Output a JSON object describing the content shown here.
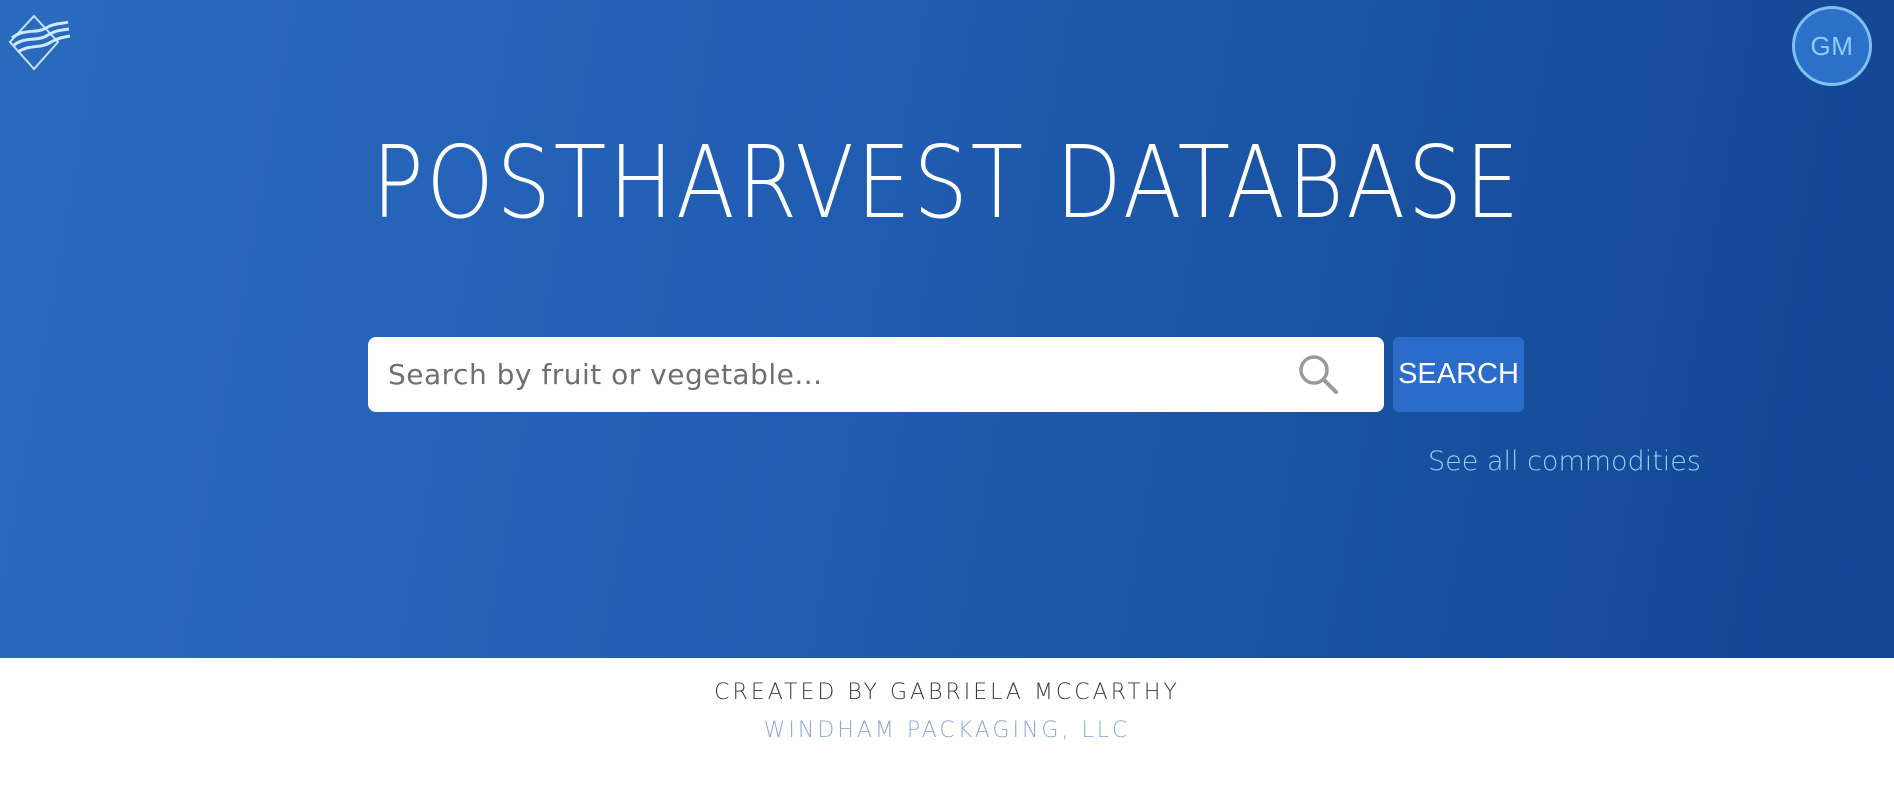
{
  "header": {
    "logo_icon": "wave-diamond-logo-icon",
    "avatar_initials": "GM"
  },
  "hero": {
    "title": "POSTHARVEST DATABASE"
  },
  "search": {
    "placeholder": "Search by fruit or vegetable...",
    "value": "",
    "icon": "search-icon",
    "button_label": "SEARCH"
  },
  "links": {
    "see_all": "See all commodities"
  },
  "footer": {
    "credit": "CREATED BY GABRIELA MCCARTHY",
    "company": "WINDHAM PACKAGING, LLC"
  },
  "colors": {
    "hero_gradient_start": "#2a6bbf",
    "hero_gradient_end": "#124592",
    "search_button": "#2b6ccb",
    "link": "#8fd4fb",
    "footer_company": "#8fa6d8"
  }
}
